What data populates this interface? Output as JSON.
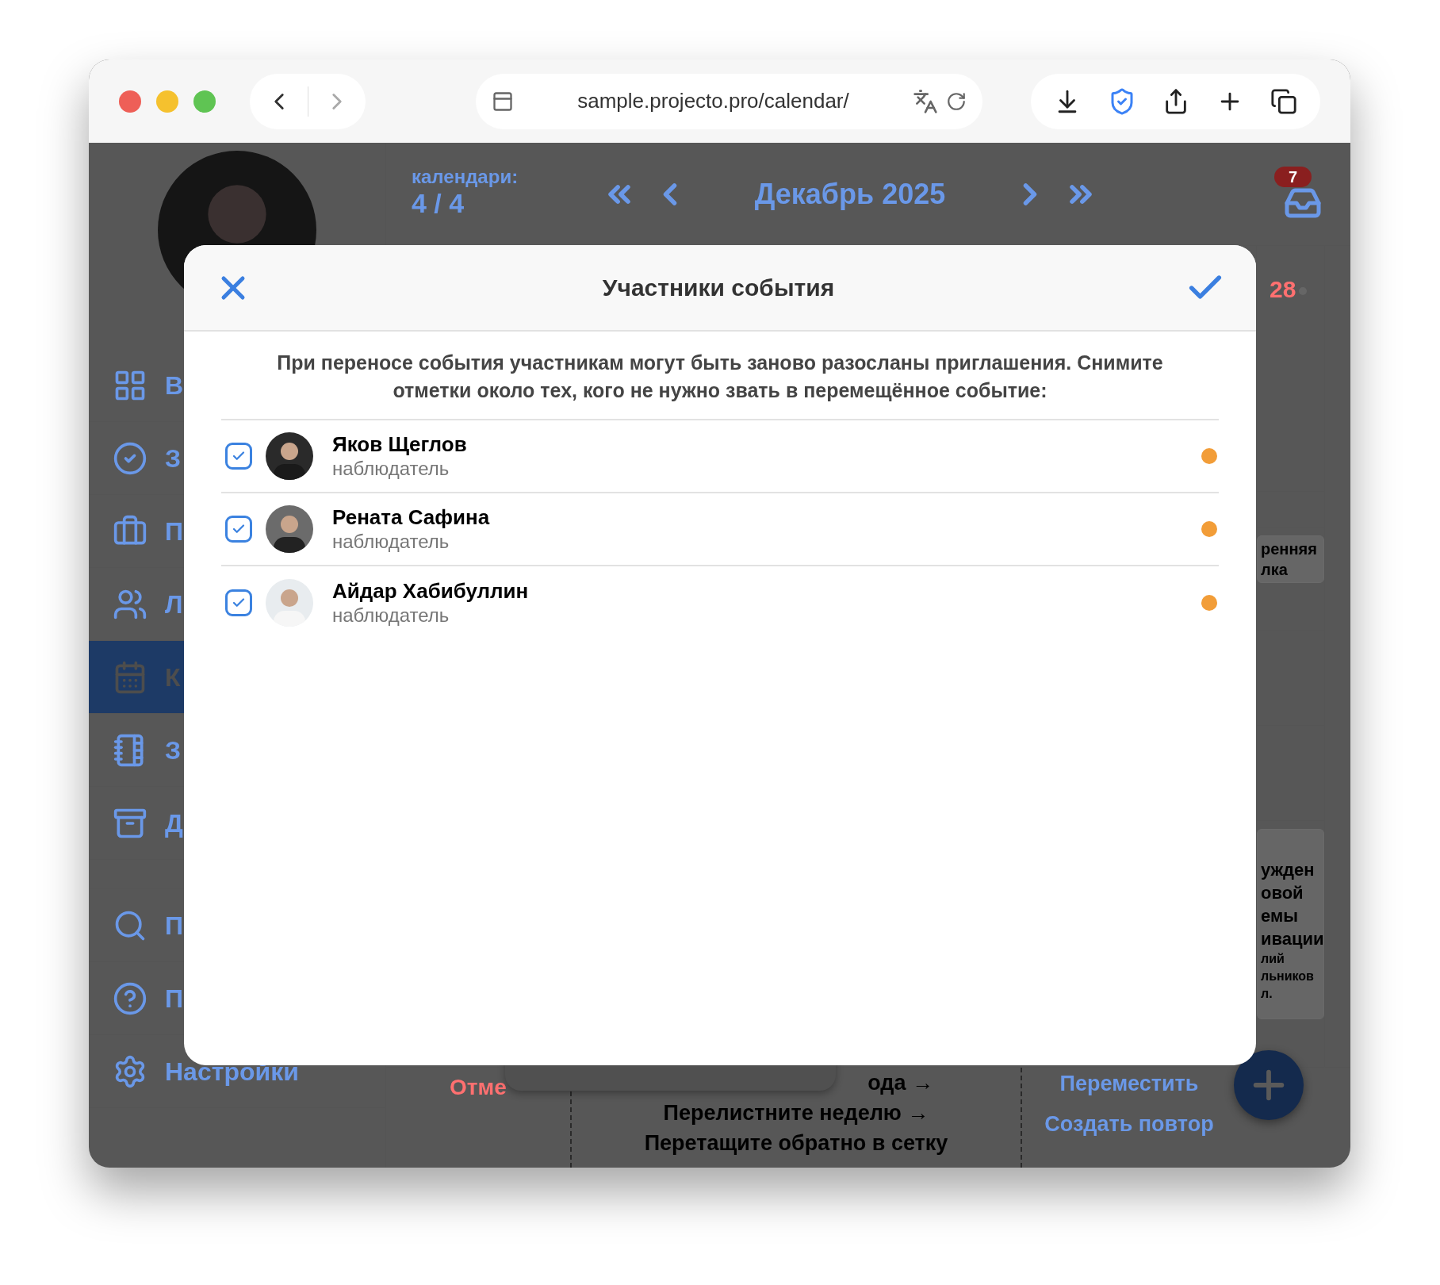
{
  "browser": {
    "url": "sample.projecto.pro/calendar/"
  },
  "sidebar": {
    "items": [
      {
        "label": "В",
        "selected": false
      },
      {
        "label": "З",
        "selected": false
      },
      {
        "label": "П",
        "selected": false
      },
      {
        "label": "Л",
        "selected": false
      },
      {
        "label": "К",
        "selected": true
      },
      {
        "label": "З",
        "selected": false
      },
      {
        "label": "Д",
        "selected": false
      }
    ],
    "bottom_items": [
      {
        "label": "П"
      },
      {
        "label": "П"
      },
      {
        "label": "Настройки"
      }
    ]
  },
  "header": {
    "calendars_label": "календари:",
    "calendars_count": "4 / 4",
    "month": "Декабрь 2025",
    "inbox_badge": "7"
  },
  "day_column": {
    "day": "28",
    "card_1": [
      "ренняя",
      "лка"
    ],
    "card_2": [
      "ужден",
      "овой",
      "емы",
      "ивации"
    ],
    "card_2_details": [
      "лий",
      "льников",
      "л."
    ]
  },
  "bottom_bar": {
    "cancel": "Отме",
    "hint_1": "ода →",
    "hint_2": "Перелистните неделю →",
    "hint_3": "Перетащите обратно в сетку",
    "actions": [
      "Переместить",
      "Создать повтор"
    ]
  },
  "dialog": {
    "title": "Участники события",
    "description": "При переносе события участникам могут быть заново разосланы приглашения. Снимите отметки около тех, кого не нужно звать в перемещённое событие:",
    "participants": [
      {
        "name": "Яков Щеглов",
        "role": "наблюдатель",
        "checked": true,
        "color": "#f29d38"
      },
      {
        "name": "Рената Сафина",
        "role": "наблюдатель",
        "checked": true,
        "color": "#f29d38"
      },
      {
        "name": "Айдар Хабибуллин",
        "role": "наблюдатель",
        "checked": true,
        "color": "#f29d38"
      }
    ]
  }
}
